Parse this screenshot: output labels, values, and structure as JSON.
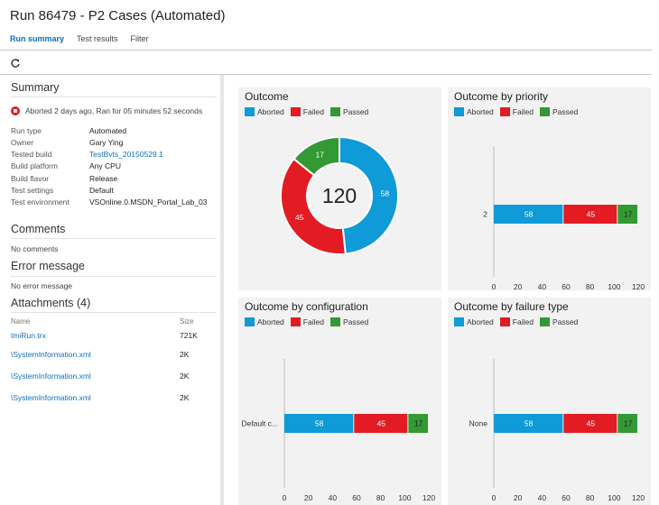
{
  "header": {
    "title": "Run 86479 - P2 Cases (Automated)",
    "tabs": [
      "Run summary",
      "Test results",
      "Filter"
    ],
    "active_tab": "Run summary"
  },
  "toolbar": {
    "refresh_icon": "refresh-icon"
  },
  "summary": {
    "title": "Summary",
    "status_text": "Aborted 2 days ago, Ran for 05 minutes 52 seconds",
    "fields": [
      {
        "key": "Run type",
        "value": "Automated",
        "link": false
      },
      {
        "key": "Owner",
        "value": "Gary Ying",
        "link": false
      },
      {
        "key": "Tested build",
        "value": "TestBvts_20150529.1",
        "link": true
      },
      {
        "key": "Build platform",
        "value": "Any CPU",
        "link": false
      },
      {
        "key": "Build flavor",
        "value": "Release",
        "link": false
      },
      {
        "key": "Test settings",
        "value": "Default",
        "link": false
      },
      {
        "key": "Test environment",
        "value": "VSOnline.0.MSDN_Portal_Lab_03",
        "link": false
      }
    ]
  },
  "comments": {
    "title": "Comments",
    "text": "No comments"
  },
  "error_message": {
    "title": "Error message",
    "text": "No error message"
  },
  "attachments": {
    "title": "Attachments (4)",
    "col_name": "Name",
    "col_size": "Size",
    "items": [
      {
        "name": "tmiRun.trx",
        "size": "721K"
      },
      {
        "name": "\\SystemInformation.xml",
        "size": "2K"
      },
      {
        "name": "\\SystemInformation.xml",
        "size": "2K"
      },
      {
        "name": "\\SystemInformation.xml",
        "size": "2K"
      }
    ]
  },
  "legend": [
    "Aborted",
    "Failed",
    "Passed"
  ],
  "colors": {
    "aborted": "#0e9bd8",
    "failed": "#e31b23",
    "passed": "#339933",
    "link": "#106ebe"
  },
  "chart_data": [
    {
      "type": "pie",
      "title": "Outcome",
      "total": "120",
      "slices": [
        {
          "name": "Aborted",
          "value": 58
        },
        {
          "name": "Failed",
          "value": 45
        },
        {
          "name": "Passed",
          "value": 17
        }
      ]
    },
    {
      "type": "bar",
      "title": "Outcome by priority",
      "orientation": "horizontal",
      "stacked": true,
      "categories": [
        "2"
      ],
      "series": [
        {
          "name": "Aborted",
          "values": [
            58
          ]
        },
        {
          "name": "Failed",
          "values": [
            45
          ]
        },
        {
          "name": "Passed",
          "values": [
            17
          ]
        }
      ],
      "xlim": [
        0,
        120
      ],
      "xticks": [
        0,
        20,
        40,
        60,
        80,
        100,
        120
      ]
    },
    {
      "type": "bar",
      "title": "Outcome by configuration",
      "orientation": "horizontal",
      "stacked": true,
      "categories": [
        "Default c..."
      ],
      "series": [
        {
          "name": "Aborted",
          "values": [
            58
          ]
        },
        {
          "name": "Failed",
          "values": [
            45
          ]
        },
        {
          "name": "Passed",
          "values": [
            17
          ]
        }
      ],
      "xlim": [
        0,
        120
      ],
      "xticks": [
        0,
        20,
        40,
        60,
        80,
        100,
        120
      ]
    },
    {
      "type": "bar",
      "title": "Outcome by failure type",
      "orientation": "horizontal",
      "stacked": true,
      "categories": [
        "None"
      ],
      "series": [
        {
          "name": "Aborted",
          "values": [
            58
          ]
        },
        {
          "name": "Failed",
          "values": [
            45
          ]
        },
        {
          "name": "Passed",
          "values": [
            17
          ]
        }
      ],
      "xlim": [
        0,
        120
      ],
      "xticks": [
        0,
        20,
        40,
        60,
        80,
        100,
        120
      ]
    }
  ]
}
